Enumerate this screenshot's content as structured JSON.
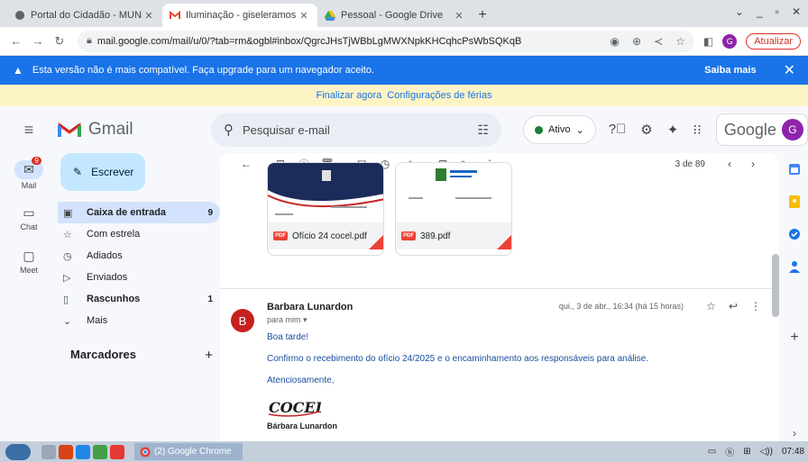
{
  "browser": {
    "tabs": [
      {
        "title": "Portal do Cidadão - MUNI",
        "active": false
      },
      {
        "title": "Iluminação - giseleramos",
        "active": true
      },
      {
        "title": "Pessoal - Google Drive",
        "active": false
      }
    ],
    "new_tab": "+",
    "url": "mail.google.com/mail/u/0/?tab=rm&ogbl#inbox/QgrcJHsTjWBbLgMWXNpkKHCqhcPsWbSQKqB",
    "profile_letter": "G",
    "update_label": "Atualizar"
  },
  "warning": {
    "text": "Esta versão não é mais compatível. Faça upgrade para um navegador aceito.",
    "more_label": "Saiba mais"
  },
  "vacation": {
    "finish_label": "Finalizar agora",
    "settings_label": "Configurações de férias"
  },
  "header": {
    "app_name": "Gmail",
    "search_placeholder": "Pesquisar e-mail",
    "status_label": "Ativo",
    "google_label": "Google",
    "avatar_letter": "G"
  },
  "rail": {
    "mail_label": "Mail",
    "mail_badge": "9",
    "chat_label": "Chat",
    "meet_label": "Meet"
  },
  "sidebar": {
    "compose_label": "Escrever",
    "items": [
      {
        "label": "Caixa de entrada",
        "count": "9"
      },
      {
        "label": "Com estrela",
        "count": ""
      },
      {
        "label": "Adiados",
        "count": ""
      },
      {
        "label": "Enviados",
        "count": ""
      },
      {
        "label": "Rascunhos",
        "count": "1"
      },
      {
        "label": "Mais",
        "count": ""
      }
    ],
    "labels_heading": "Marcadores"
  },
  "toolbar": {
    "pagination": "3 de 89"
  },
  "attachments": [
    {
      "name": "Ofício 24 cocel.pdf",
      "type": "PDF"
    },
    {
      "name": "389.pdf",
      "type": "PDF"
    }
  ],
  "message": {
    "avatar_letter": "B",
    "sender": "Barbara Lunardon",
    "to": "para mim",
    "date": "qui., 3 de abr., 16:34 (há 15 horas)",
    "greeting": "Boa tarde!",
    "body": "Confirmo o recebimento do ofício 24/2025 e o encaminhamento aos responsáveis para análise.",
    "closing": "Atenciosamente,",
    "signature_logo": "COCEL",
    "signature_name": "Bárbara Lunardon"
  },
  "taskbar": {
    "chrome_label": "(2) Google Chrome",
    "clock": "07:48"
  },
  "colors": {
    "warning_bar": "#1a73e8",
    "vacation_bar": "#fdf4c5",
    "active_nav": "#d3e3fd",
    "compose": "#c2e7ff",
    "avatar_b": "#c5221f"
  }
}
